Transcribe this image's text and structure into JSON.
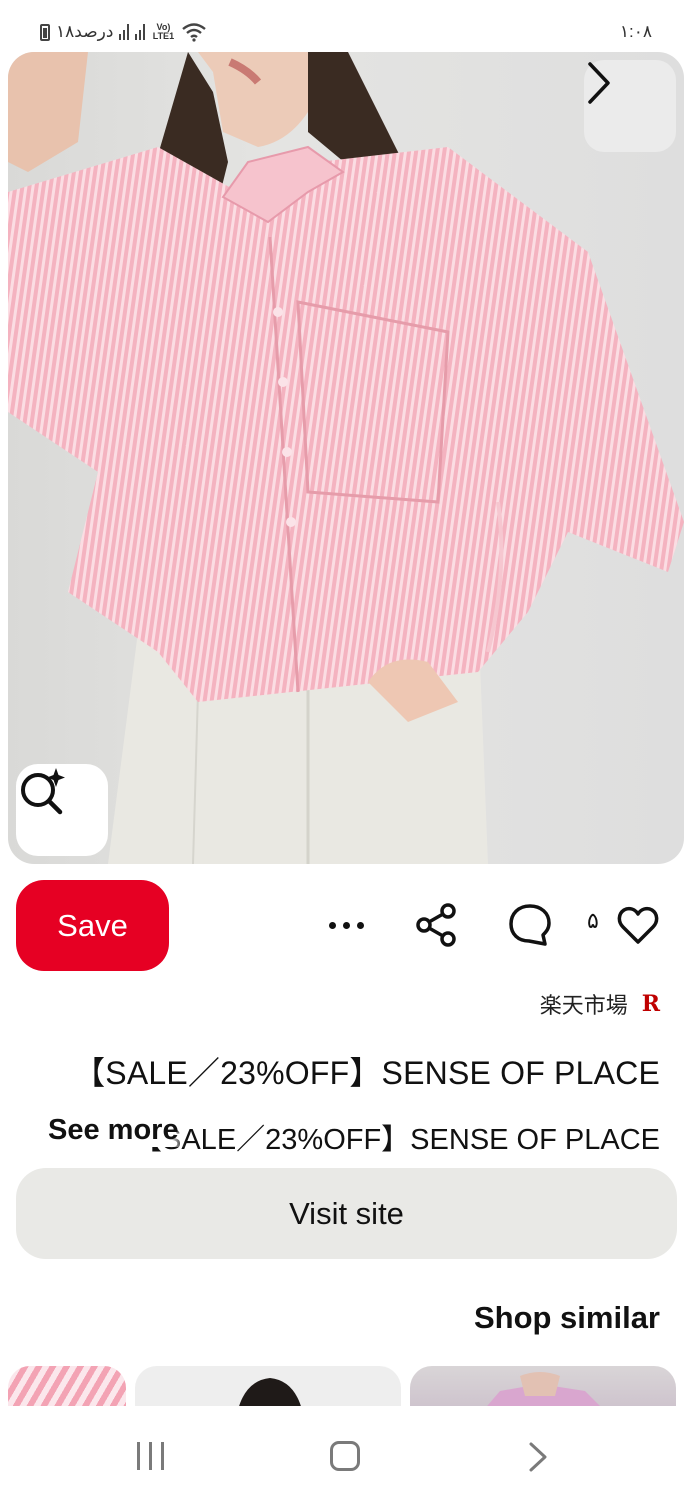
{
  "status_bar": {
    "battery_text": "۱۸درصد",
    "network": "Vo) LTE1",
    "time": "۱:۰۸"
  },
  "pin": {
    "image_icon_next": "chevron-right-icon",
    "image_icon_lens": "visual-search-icon"
  },
  "actions": {
    "save_label": "Save",
    "reaction_count": "۵",
    "icons": [
      "more-icon",
      "share-icon",
      "comment-icon",
      "heart-icon"
    ]
  },
  "source": {
    "name": "楽天市場",
    "logo": "R"
  },
  "title": "【SALE／23%OFF】SENSE OF PLACE",
  "description": {
    "text": "【SALE／23%OFF】SENSE OF PLACE",
    "see_more_label": "See more"
  },
  "visit_label": "Visit site",
  "shop_similar_label": "Shop similar",
  "colors": {
    "save_red": "#e60023",
    "visit_gray": "#e9e9e6",
    "rakuten_red": "#bf0000"
  }
}
